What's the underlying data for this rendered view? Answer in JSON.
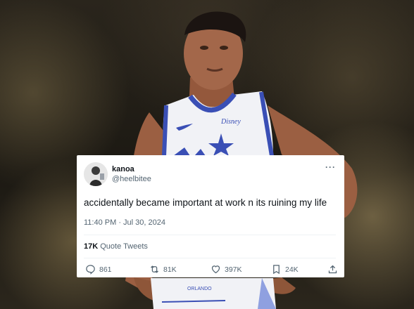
{
  "tweet": {
    "display_name": "kanoa",
    "handle": "@heelbitee",
    "more": "···",
    "text": "accidentally became important at work n its ruining my life",
    "timestamp": "11:40 PM · Jul 30, 2024",
    "quote_count": "17K",
    "quote_label": "Quote Tweets",
    "actions": {
      "replies": "861",
      "retweets": "81K",
      "likes": "397K",
      "bookmarks": "24K"
    }
  },
  "jersey": {
    "chest_logo": "Disney",
    "team": "ORLANDO"
  },
  "colors": {
    "jersey_white": "#f1f2f6",
    "jersey_trim": "#3a4fb5",
    "skin": "#a3674a",
    "muted_text": "#536471"
  }
}
